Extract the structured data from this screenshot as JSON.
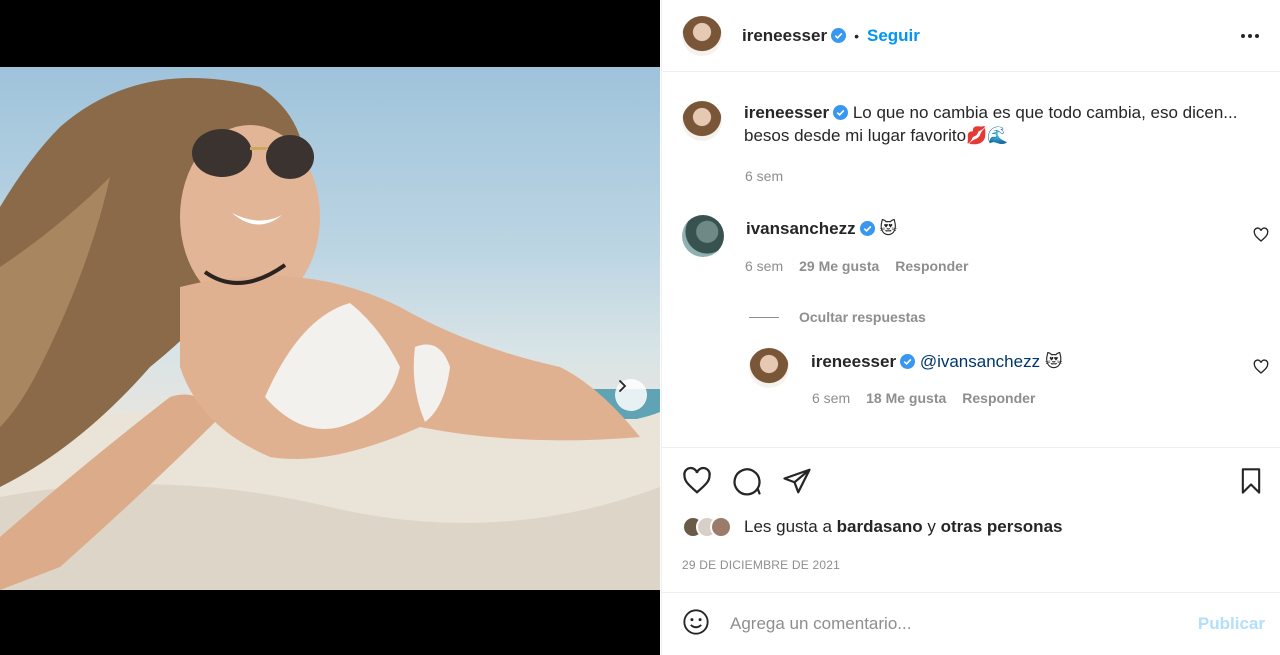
{
  "post": {
    "username": "ireneesser",
    "follow_label": "Seguir",
    "separator": "•",
    "date": "29 DE DICIEMBRE DE 2021",
    "carousel_dots": 2
  },
  "caption": {
    "username": "ireneesser",
    "text_line1": "Lo que no cambia es que todo cambia, eso dicen...",
    "text_line2": "besos desde mi lugar favorito💋🌊",
    "time": "6 sem"
  },
  "comments": [
    {
      "username": "ivansanchezz",
      "text": "😻",
      "time": "6 sem",
      "likes": "29 Me gusta",
      "reply_label": "Responder"
    }
  ],
  "hide_replies_label": "Ocultar respuestas",
  "replies": [
    {
      "username": "ireneesser",
      "mention": "@ivansanchezz",
      "text": "😻",
      "time": "6 sem",
      "likes": "18 Me gusta",
      "reply_label": "Responder"
    }
  ],
  "likes_summary": {
    "prefix": "Les gusta a",
    "user": "bardasano",
    "connector": "y",
    "others": "otras personas"
  },
  "composer": {
    "placeholder": "Agrega un comentario...",
    "publish_label": "Publicar"
  },
  "colors": {
    "accent": "#0095f6",
    "publish_disabled": "#b2dffc",
    "muted": "#8e8e8e"
  }
}
